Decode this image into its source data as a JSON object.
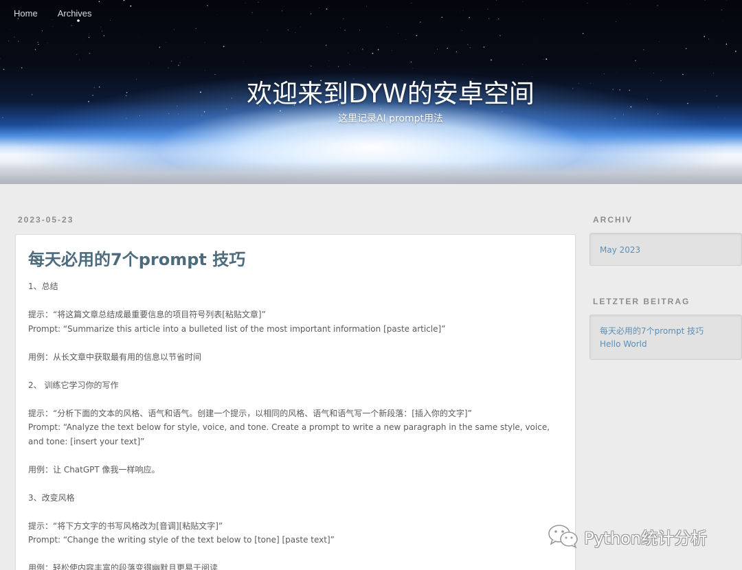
{
  "nav": {
    "items": [
      {
        "label": "Home"
      },
      {
        "label": "Archives"
      }
    ]
  },
  "header": {
    "title": "欢迎来到DYW的安卓空间",
    "subtitle": "这里记录AI prompt用法"
  },
  "post": {
    "date": "2023-05-23",
    "title": "每天必用的7个prompt 技巧",
    "paragraphs": [
      [
        "1、总结"
      ],
      [
        "提示：“将这篇文章总结成最重要信息的项目符号列表[粘贴文章]”",
        "Prompt: “Summarize this article into a bulleted list of the most important information [paste article]”"
      ],
      [
        "用例：从长文章中获取最有用的信息以节省时间"
      ],
      [
        "2、 训练它学习你的写作"
      ],
      [
        "提示：“分析下面的文本的风格、语气和语气。创建一个提示，以相同的风格、语气和语气写一个新段落：[插入你的文字]”",
        "Prompt: “Analyze the text below for style, voice, and tone. Create a prompt to write a new paragraph in the same style, voice, and tone: [insert your text]”"
      ],
      [
        "用例：让 ChatGPT 像我一样响应。"
      ],
      [
        "3、改变风格"
      ],
      [
        "提示：“将下方文字的书写风格改为[音调][粘贴文字]”",
        "Prompt: “Change the writing style of the text below to [tone] [paste text]”"
      ],
      [
        "用例：轻松使内容丰富的段落变得幽默且更易于阅读"
      ]
    ]
  },
  "sidebar": {
    "archive": {
      "heading": "ARCHIV",
      "links": [
        {
          "label": "May 2023"
        }
      ]
    },
    "latest": {
      "heading": "LETZTER BEITRAG",
      "links": [
        {
          "label": "每天必用的7个prompt 技巧"
        },
        {
          "label": "Hello World"
        }
      ]
    }
  },
  "watermark": {
    "text": "Python统计分析",
    "icon": "wechat-icon"
  }
}
